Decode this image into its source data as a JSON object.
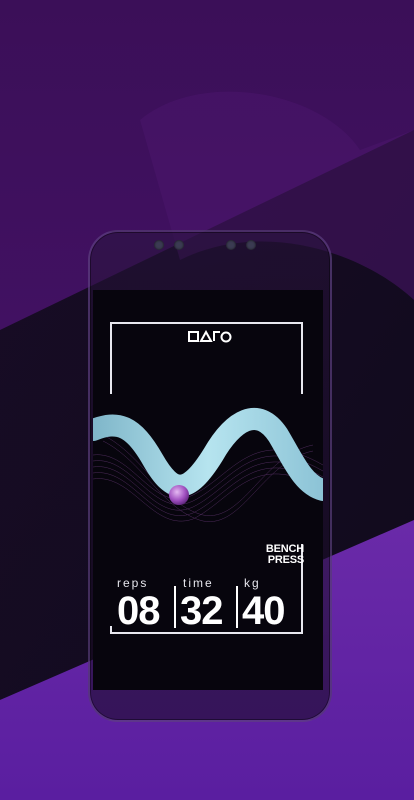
{
  "brand": {
    "logo_icon": "dano-logo-icon"
  },
  "exercise": {
    "line1": "BENCH",
    "line2": "PRESS"
  },
  "stats": [
    {
      "label": "reps",
      "value": "08"
    },
    {
      "label": "time",
      "value": "32"
    },
    {
      "label": "kg",
      "value": "40"
    }
  ],
  "colors": {
    "background": "#2a0a3e",
    "accent": "#a5dbe8",
    "ball": "#a85bc4"
  }
}
